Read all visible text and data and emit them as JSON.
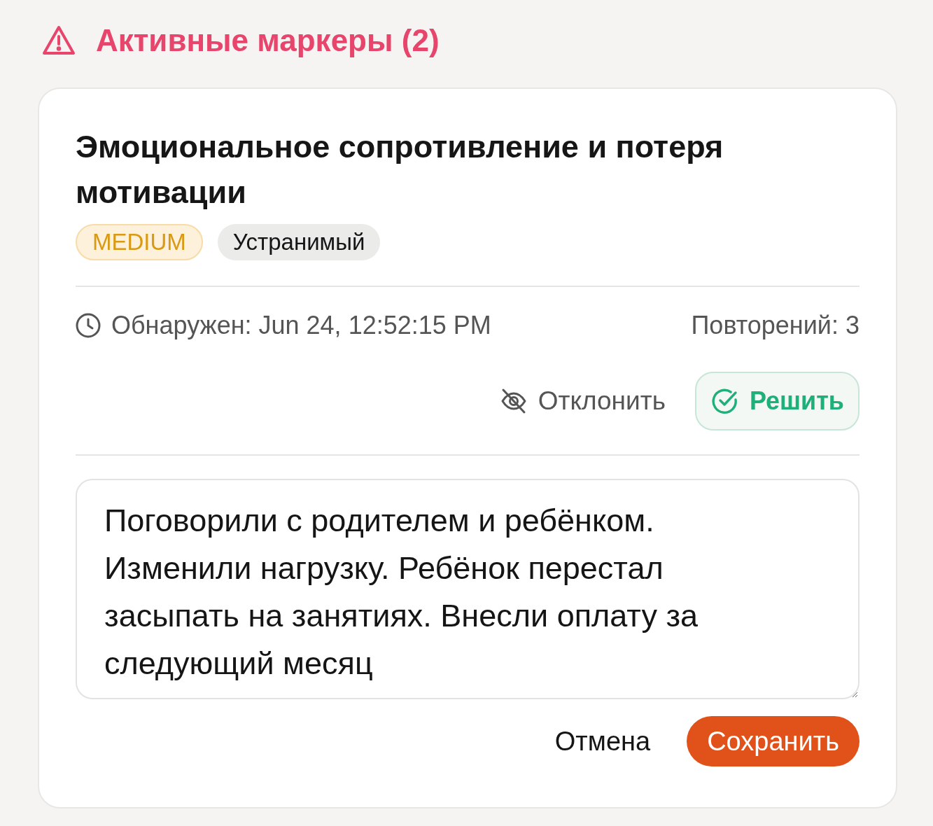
{
  "header": {
    "title": "Активные маркеры (2)"
  },
  "marker": {
    "title": "Эмоциональное сопротивление и потеря мотивации",
    "badges": [
      {
        "label": "MEDIUM",
        "kind": "severity"
      },
      {
        "label": "Устранимый",
        "kind": "category"
      }
    ],
    "detected": "Обнаружен: Jun 24, 12:52:15 PM",
    "repeats": "Повторений: 3",
    "actions": [
      {
        "label": "Отклонить",
        "kind": "dismiss"
      },
      {
        "label": "Решить",
        "kind": "resolve"
      }
    ],
    "note": {
      "value": "Поговорили с родителем и ребёнком. Изменили нагрузку. Ребёнок перестал засыпать на занятиях. Внесли оплату за следующий месяц"
    },
    "buttons": [
      {
        "label": "Отмена",
        "kind": "cancel"
      },
      {
        "label": "Сохранить",
        "kind": "save"
      }
    ]
  }
}
